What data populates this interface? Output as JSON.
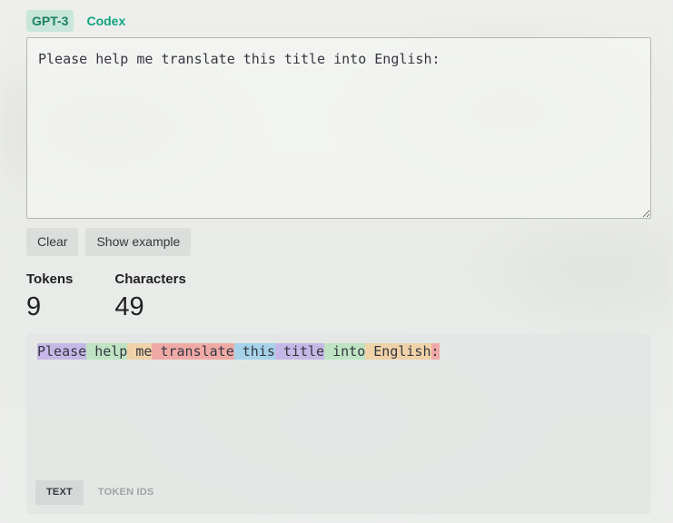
{
  "model_tabs": [
    {
      "label": "GPT-3",
      "active": true
    },
    {
      "label": "Codex",
      "active": false
    }
  ],
  "prompt": {
    "value": "Please help me translate this title into English:"
  },
  "actions": {
    "clear_label": "Clear",
    "example_label": "Show example"
  },
  "stats": {
    "tokens_label": "Tokens",
    "tokens_value": "9",
    "characters_label": "Characters",
    "characters_value": "49"
  },
  "tokens": [
    {
      "text": "Please",
      "color": "#c6b8e6"
    },
    {
      "text": " help",
      "color": "#bfe3c3"
    },
    {
      "text": " me",
      "color": "#f0d2a8"
    },
    {
      "text": " translate",
      "color": "#efaaa6"
    },
    {
      "text": " this",
      "color": "#a6d3ea"
    },
    {
      "text": " title",
      "color": "#c6b8e6"
    },
    {
      "text": " into",
      "color": "#bfe3c3"
    },
    {
      "text": " English",
      "color": "#f0d2a8"
    },
    {
      "text": ":",
      "color": "#efaaa6"
    }
  ],
  "view_toggle": {
    "text_label": "TEXT",
    "token_ids_label": "TOKEN IDS"
  },
  "colors": {
    "accent": "#10a37f",
    "accent_bg": "#c8e6d9"
  }
}
